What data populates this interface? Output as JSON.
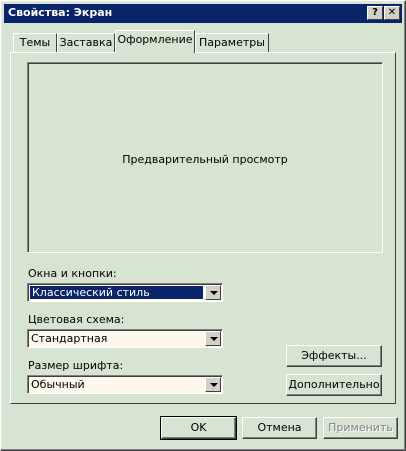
{
  "window": {
    "title": "Свойства: Экран",
    "help_label": "?",
    "close_label": "✕"
  },
  "tabs": [
    {
      "label": "Темы",
      "active": false
    },
    {
      "label": "Заставка",
      "active": false
    },
    {
      "label": "Оформление",
      "active": true
    },
    {
      "label": "Параметры",
      "active": false
    }
  ],
  "preview": {
    "text": "Предварительный просмотр"
  },
  "windows_buttons": {
    "label": "Окна и кнопки:",
    "value": "Классический стиль"
  },
  "color_scheme": {
    "label": "Цветовая схема:",
    "value": "Стандартная"
  },
  "font_size": {
    "label": "Размер шрифта:",
    "value": "Обычный"
  },
  "buttons": {
    "effects": "Эффекты...",
    "advanced": "Дополнительно",
    "ok": "OK",
    "cancel": "Отмена",
    "apply": "Применить"
  },
  "colors": {
    "titlebar": "#0a246a",
    "face": "#d7e4d2",
    "selection": "#0a246a"
  },
  "icons": [
    "help-icon",
    "close-icon",
    "chevron-down-icon"
  ]
}
